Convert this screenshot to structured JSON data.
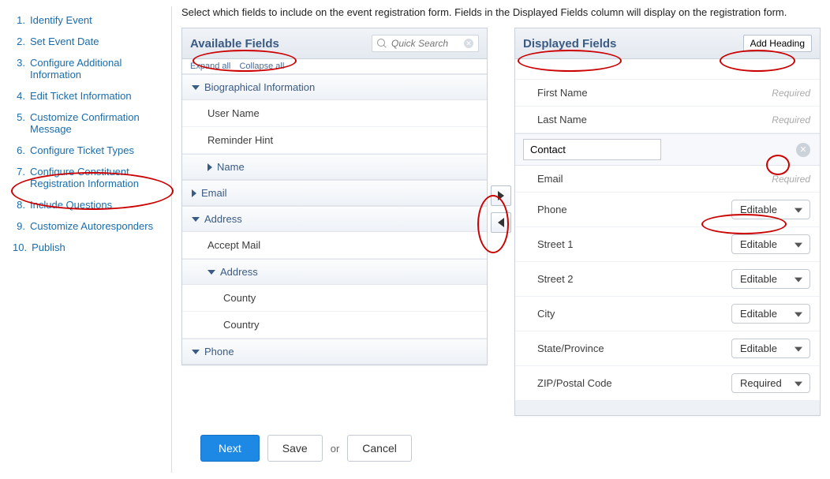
{
  "instructions": "Select which fields to include on the event registration form. Fields in the Displayed Fields column will display on the registration form.",
  "sidebar": {
    "steps": [
      {
        "num": "1.",
        "label": "Identify Event"
      },
      {
        "num": "2.",
        "label": "Set Event Date"
      },
      {
        "num": "3.",
        "label": "Configure Additional Information"
      },
      {
        "num": "4.",
        "label": "Edit Ticket Information"
      },
      {
        "num": "5.",
        "label": "Customize Confirmation Message"
      },
      {
        "num": "6.",
        "label": "Configure Ticket Types"
      },
      {
        "num": "7.",
        "label": "Configure Constituent Registration Information"
      },
      {
        "num": "8.",
        "label": "Include Questions"
      },
      {
        "num": "9.",
        "label": "Customize Autoresponders"
      },
      {
        "num": "10.",
        "label": "Publish"
      }
    ]
  },
  "available": {
    "title": "Available Fields",
    "expand": "Expand all",
    "collapse": "Collapse all",
    "search_placeholder": "Quick Search",
    "groups": {
      "bio": "Biographical Information",
      "bio_user": "User Name",
      "bio_hint": "Reminder Hint",
      "bio_name": "Name",
      "email": "Email",
      "address": "Address",
      "addr_accept": "Accept Mail",
      "addr_sub": "Address",
      "addr_county": "County",
      "addr_country": "Country",
      "phone": "Phone"
    }
  },
  "displayed": {
    "title": "Displayed Fields",
    "add_heading": "Add Heading",
    "required": "Required",
    "heading_value": "Contact",
    "fields": {
      "first": "First Name",
      "last": "Last Name",
      "email": "Email",
      "phone": "Phone",
      "street1": "Street 1",
      "street2": "Street 2",
      "city": "City",
      "state": "State/Province",
      "zip": "ZIP/Postal Code"
    },
    "sel_editable": "Editable",
    "sel_required": "Required"
  },
  "buttons": {
    "next": "Next",
    "save": "Save",
    "or": "or",
    "cancel": "Cancel"
  }
}
